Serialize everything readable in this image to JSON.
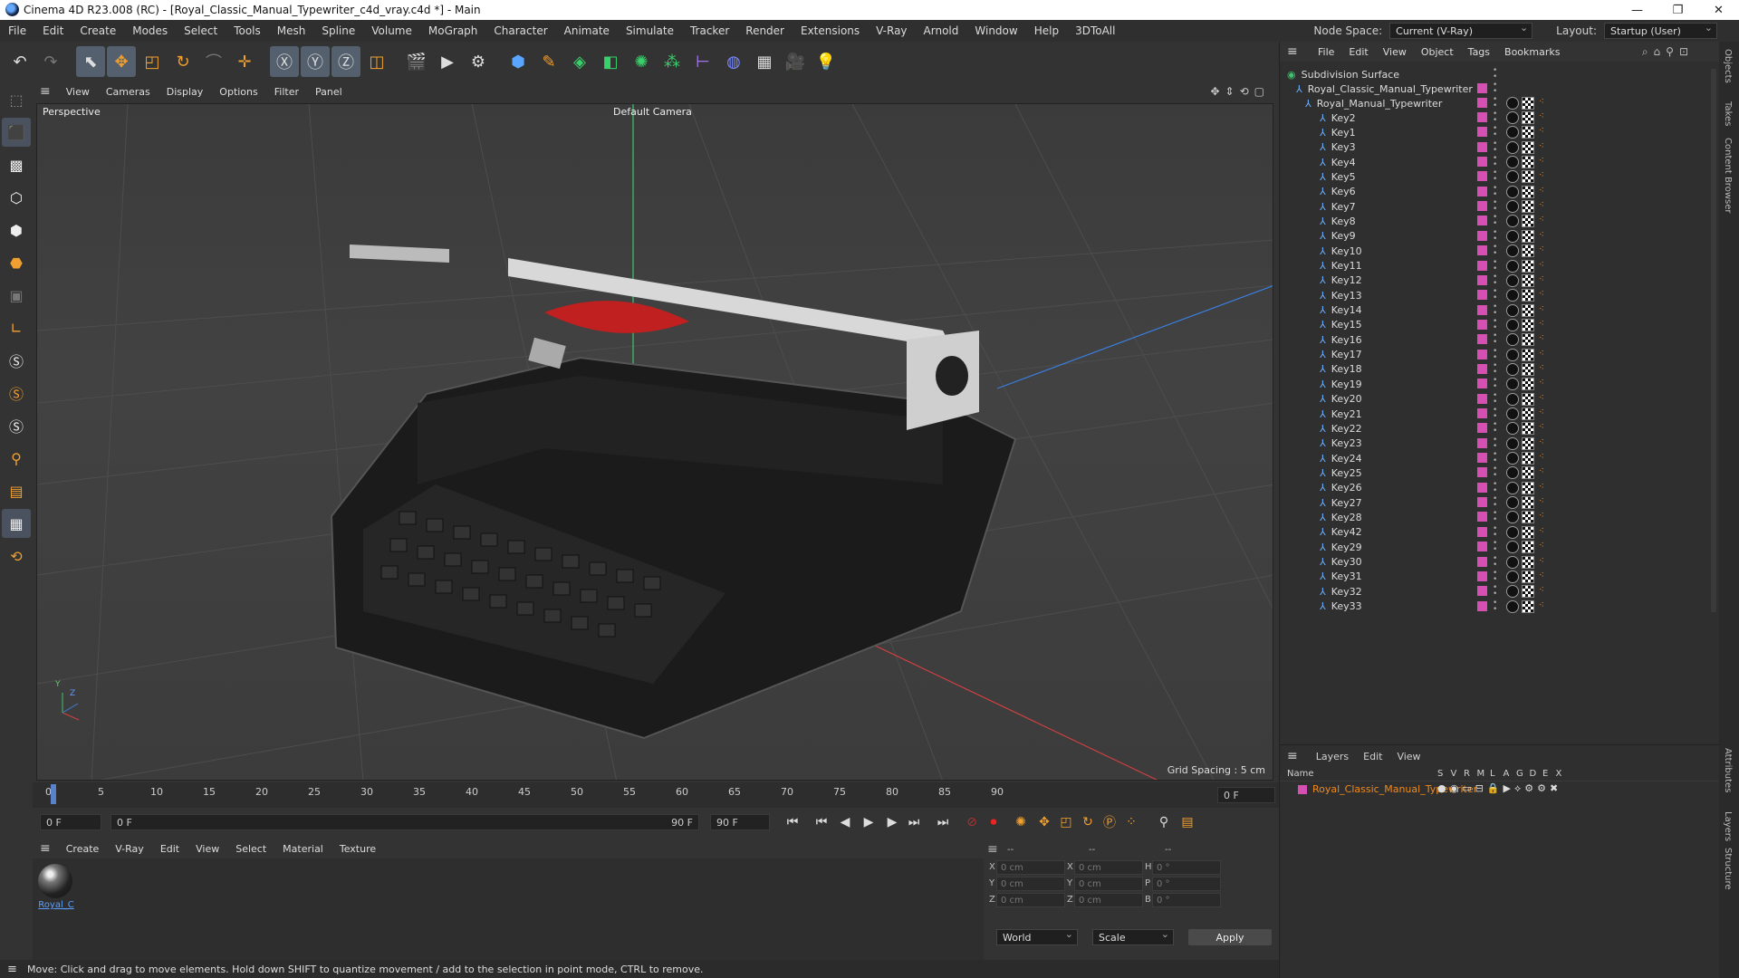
{
  "window": {
    "title": "Cinema 4D R23.008 (RC) - [Royal_Classic_Manual_Typewriter_c4d_vray.c4d *] - Main",
    "controls": [
      "minimize",
      "maximize",
      "close"
    ]
  },
  "menubar": {
    "items": [
      "File",
      "Edit",
      "Create",
      "Modes",
      "Select",
      "Tools",
      "Mesh",
      "Spline",
      "Volume",
      "MoGraph",
      "Character",
      "Animate",
      "Simulate",
      "Tracker",
      "Render",
      "Extensions",
      "V-Ray",
      "Arnold",
      "Window",
      "Help",
      "3DToAll"
    ],
    "node_space_label": "Node Space:",
    "node_space_value": "Current (V-Ray)",
    "layout_label": "Layout:",
    "layout_value": "Startup (User)"
  },
  "viewport": {
    "menu": [
      "View",
      "Cameras",
      "Display",
      "Options",
      "Filter",
      "Panel"
    ],
    "projection": "Perspective",
    "camera": "Default Camera",
    "grid_spacing": "Grid Spacing : 5 cm",
    "axis_labels": [
      "Y",
      "Z",
      "X"
    ]
  },
  "timeline": {
    "ticks": [
      "0",
      "5",
      "10",
      "15",
      "20",
      "25",
      "30",
      "35",
      "40",
      "45",
      "50",
      "55",
      "60",
      "65",
      "70",
      "75",
      "80",
      "85",
      "90"
    ],
    "current_frame_right": "0 F",
    "start_field": "0 F",
    "range_start": "0 F",
    "range_end": "90 F",
    "end_field": "90 F"
  },
  "material_manager": {
    "menu": [
      "Create",
      "V-Ray",
      "Edit",
      "View",
      "Select",
      "Material",
      "Texture"
    ],
    "material_label": "Royal_C"
  },
  "coordinates": {
    "headers": [
      "--",
      "--",
      "--"
    ],
    "rows": [
      {
        "a": "X",
        "av": "0 cm",
        "b": "X",
        "bv": "0 cm",
        "c": "H",
        "cv": "0 °"
      },
      {
        "a": "Y",
        "av": "0 cm",
        "b": "Y",
        "bv": "0 cm",
        "c": "P",
        "cv": "0 °"
      },
      {
        "a": "Z",
        "av": "0 cm",
        "b": "Z",
        "bv": "0 cm",
        "c": "B",
        "cv": "0 °"
      }
    ],
    "mode1": "World",
    "mode2": "Scale",
    "apply": "Apply"
  },
  "status": "Move: Click and drag to move elements. Hold down SHIFT to quantize movement / add to the selection in point mode, CTRL to remove.",
  "object_manager": {
    "menu": [
      "File",
      "Edit",
      "View",
      "Object",
      "Tags",
      "Bookmarks"
    ],
    "root": "Subdivision Surface",
    "child": "Royal_Classic_Manual_Typewriter",
    "grandchild": "Royal_Manual_Typewriter",
    "keys": [
      "Key2",
      "Key1",
      "Key3",
      "Key4",
      "Key5",
      "Key6",
      "Key7",
      "Key8",
      "Key9",
      "Key10",
      "Key11",
      "Key12",
      "Key13",
      "Key14",
      "Key15",
      "Key16",
      "Key17",
      "Key18",
      "Key19",
      "Key20",
      "Key21",
      "Key22",
      "Key23",
      "Key24",
      "Key25",
      "Key26",
      "Key27",
      "Key28",
      "Key42",
      "Key29",
      "Key30",
      "Key31",
      "Key32",
      "Key33"
    ]
  },
  "layers": {
    "menu": [
      "Layers",
      "Edit",
      "View"
    ],
    "name_header": "Name",
    "col_headers": [
      "S",
      "V",
      "R",
      "M",
      "L",
      "A",
      "G",
      "D",
      "E",
      "X"
    ],
    "layer_name": "Royal_Classic_Manual_Typewriter",
    "layer_color": "#d64fb2"
  },
  "side_tabs": [
    "Objects",
    "Takes",
    "Content Browser",
    "Attributes",
    "Layers",
    "Structure"
  ],
  "colors": {
    "accent": "#d64fb2",
    "selection": "#f08a1c",
    "link": "#5aa0ff"
  }
}
